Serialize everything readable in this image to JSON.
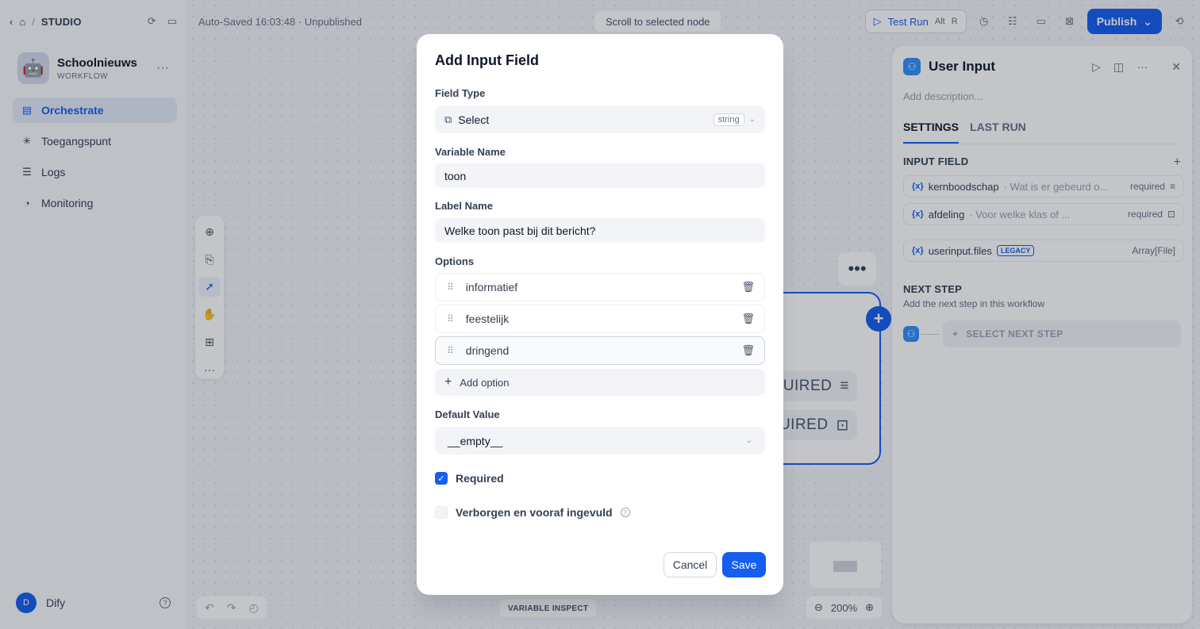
{
  "sidebar": {
    "studio_label": "STUDIO",
    "breadcrumb_sep": "/",
    "app_name": "Schoolnieuws",
    "app_type": "WORKFLOW",
    "app_emoji": "🤖",
    "nav": [
      {
        "label": "Orchestrate",
        "active": true
      },
      {
        "label": "Toegangspunt"
      },
      {
        "label": "Logs"
      },
      {
        "label": "Monitoring"
      }
    ],
    "user_initial": "D",
    "user_name": "Dify"
  },
  "topbar": {
    "autosave": "Auto-Saved 16:03:48 · Unpublished",
    "scroll_to_selected": "Scroll to selected node",
    "test_run": "Test Run",
    "shortcut_alt": "Alt",
    "shortcut_r": "R",
    "publish": "Publish"
  },
  "canvas": {
    "node_rows": [
      "UIRED",
      "UIRED"
    ],
    "zoom": "200%",
    "variable_inspect": "VARIABLE INSPECT"
  },
  "panel": {
    "title": "User Input",
    "description_placeholder": "Add description...",
    "tabs": [
      "SETTINGS",
      "LAST RUN"
    ],
    "input_field_section": "INPUT FIELD",
    "fields": [
      {
        "name": "kernboodschap",
        "label": "· Wat is er gebeurd o...",
        "required": "required"
      },
      {
        "name": "afdeling",
        "label": "· Voor welke klas of ...",
        "required": "required"
      }
    ],
    "legacy_field": {
      "name": "userinput.files",
      "badge": "LEGACY",
      "type": "Array[File]"
    },
    "next_step_section": "NEXT STEP",
    "next_step_sub": "Add the next step in this workflow",
    "select_next_step": "SELECT NEXT STEP"
  },
  "modal": {
    "title": "Add Input Field",
    "field_type_label": "Field Type",
    "field_type_value": "Select",
    "field_type_badge": "string",
    "variable_name_label": "Variable Name",
    "variable_name_value": "toon",
    "label_name_label": "Label Name",
    "label_name_value": "Welke toon past bij dit bericht?",
    "options_label": "Options",
    "options": [
      "informatief",
      "feestelijk",
      "dringend"
    ],
    "add_option": "Add option",
    "default_value_label": "Default Value",
    "default_value": "__empty__",
    "required_label": "Required",
    "required_checked": true,
    "hidden_label": "Verborgen en vooraf ingevuld",
    "hidden_checked": false,
    "cancel": "Cancel",
    "save": "Save"
  },
  "colors": {
    "accent": "#155eef",
    "overlay": "rgba(16,24,40,0.25)"
  }
}
